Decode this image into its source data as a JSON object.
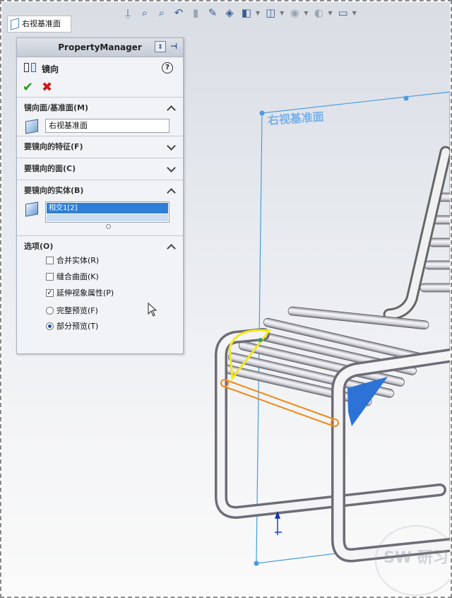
{
  "toolbar": {
    "icons": [
      "view-orientation-icon",
      "zoom-to-fit-icon",
      "zoom-area-icon",
      "previous-view-icon",
      "section-view-icon",
      "dynamic-annotation-icon",
      "view-cube-icon",
      "display-style-icon",
      "hide-show-icon",
      "edit-appearance-icon",
      "apply-scene-icon",
      "view-settings-icon"
    ]
  },
  "breadcrumb": {
    "label": "右视基准面"
  },
  "property_manager": {
    "title": "PropertyManager",
    "feature_name": "镜向",
    "help": "?",
    "ok": "✔",
    "cancel": "✖",
    "groups": {
      "mirror_plane": {
        "header": "镜向面/基准面(M)",
        "value": "右视基准面"
      },
      "features": {
        "header": "要镜向的特征(F)"
      },
      "faces": {
        "header": "要镜向的面(C)"
      },
      "bodies": {
        "header": "要镜向的实体(B)",
        "selected": "相交1[2]"
      },
      "options": {
        "header": "选项(O)",
        "merge_solids": {
          "label": "合并实体(R)",
          "checked": false
        },
        "knit_surfaces": {
          "label": "缝合曲面(K)",
          "checked": false
        },
        "propagate_visual": {
          "label": "延伸视象属性(P)",
          "checked": true
        },
        "full_preview": {
          "label": "完整预览(F)",
          "selected": false
        },
        "partial_preview": {
          "label": "部分预览(T)",
          "selected": true
        }
      }
    }
  },
  "viewport": {
    "plane_label": "右视基准面",
    "watermark": "SW 研习社",
    "colors": {
      "plane": "#4a9be0",
      "sketch_yellow": "#f2ea1a",
      "sketch_orange": "#f08a1a",
      "mirror_body": "#2d73d6",
      "tube": "#e9e9ee"
    }
  }
}
